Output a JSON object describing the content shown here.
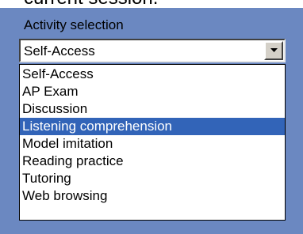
{
  "heading_fragment": "current session.",
  "panel": {
    "title": "Activity selection"
  },
  "combo": {
    "selected_value": "Self-Access",
    "button_icon": "chevron-down-icon"
  },
  "list": {
    "items": [
      "Self-Access",
      "AP Exam",
      "Discussion",
      "Listening comprehension",
      "Model imitation",
      "Reading practice",
      "Tutoring",
      "Web browsing"
    ],
    "highlighted_item": "Listening comprehension"
  },
  "colors": {
    "panel_background": "#6b88c1",
    "highlight": "#3264b8"
  }
}
